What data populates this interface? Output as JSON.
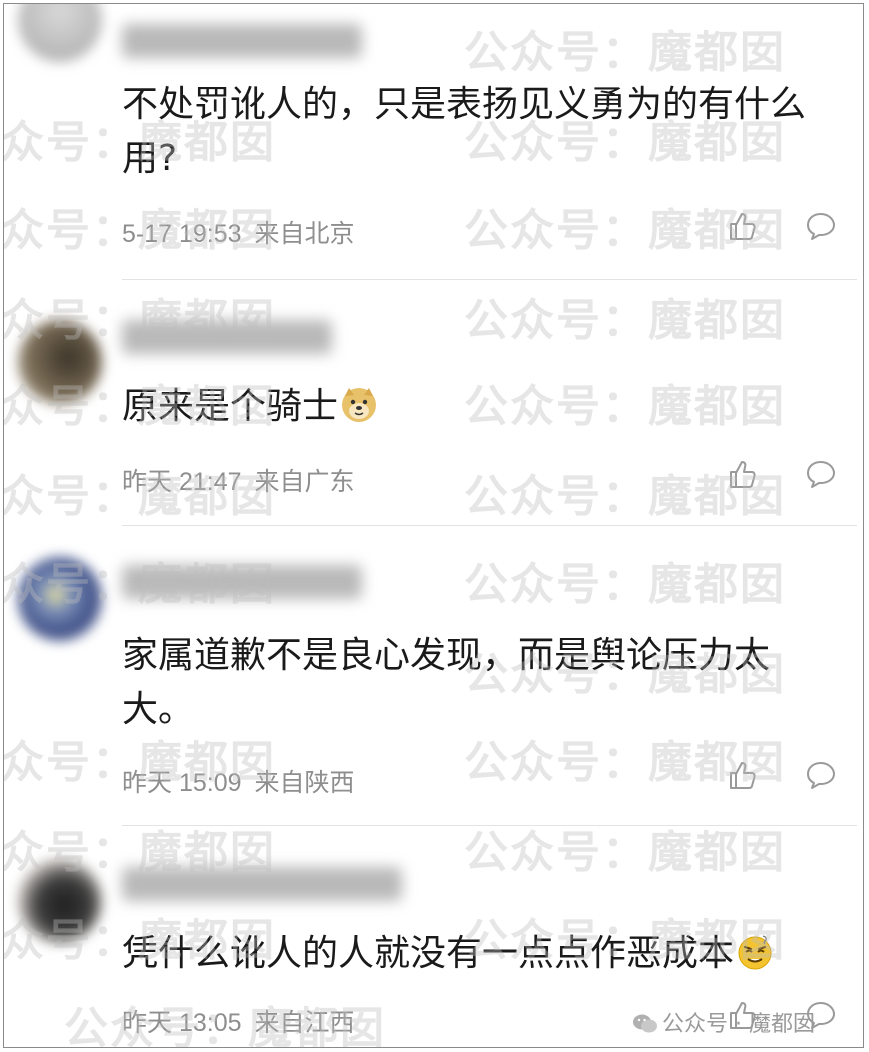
{
  "watermark": "公众号：魔都囡",
  "source_tag": "公众号 · 魔都囡",
  "comments": [
    {
      "text": "不处罚讹人的，只是表扬见义勇为的有什么用?",
      "time": "5-17 19:53",
      "location": "来自北京"
    },
    {
      "text": "原来是个骑士",
      "emoji": "doge-emoji",
      "time": "昨天 21:47",
      "location": "来自广东"
    },
    {
      "text": "家属道歉不是良心发现，而是舆论压力太大。",
      "time": "昨天 15:09",
      "location": "来自陕西"
    },
    {
      "text": "凭什么讹人的人就没有一点点作恶成本",
      "emoji": "dizzy-face-emoji",
      "time": "昨天 13:05",
      "location": "来自江西"
    }
  ],
  "icons": {
    "like": "thumbs-up-icon",
    "reply": "comment-bubble-icon"
  }
}
